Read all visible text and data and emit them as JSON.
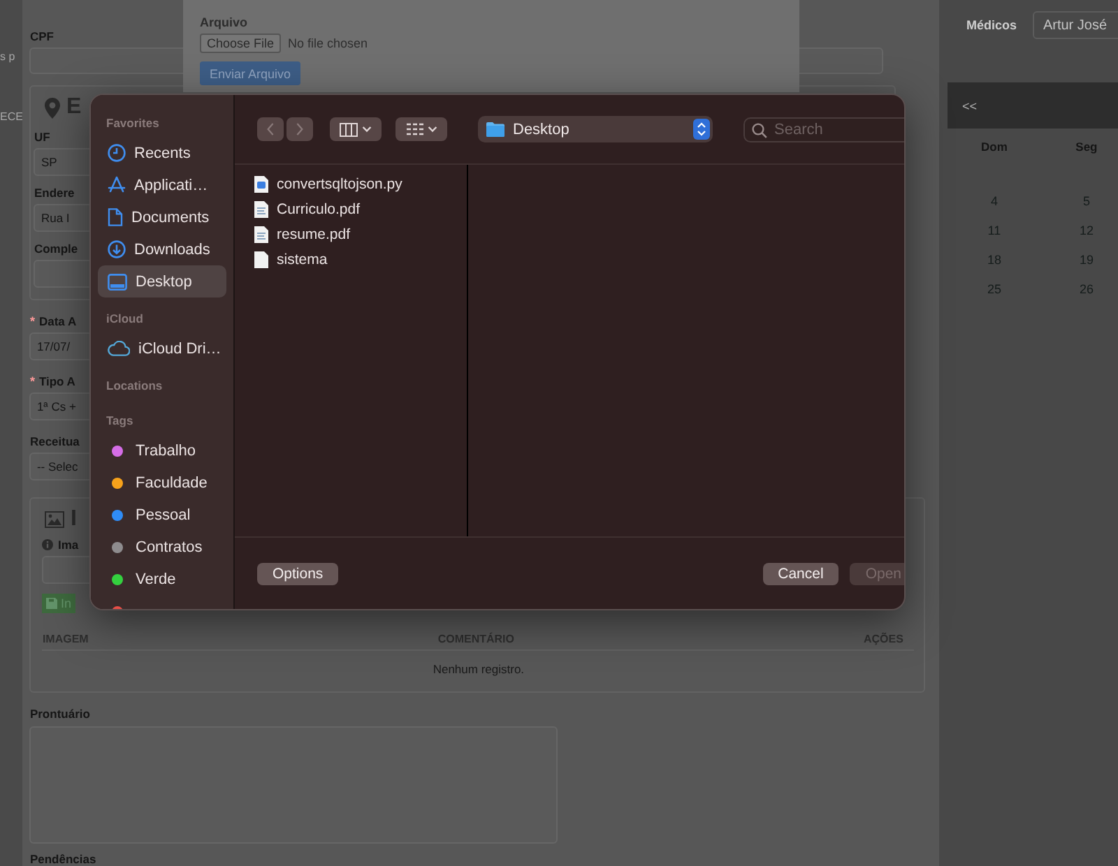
{
  "form": {
    "side_fragments": [
      "s p",
      "ECE"
    ],
    "cpf_label": "CPF",
    "address": {
      "title": "E",
      "fields": [
        {
          "label": "UF",
          "value": "SP"
        },
        {
          "label": "Endere",
          "value": "Rua I"
        },
        {
          "label": "Comple"
        }
      ]
    },
    "fields": [
      {
        "mark": "*",
        "label": "Data A",
        "value": "17/07/"
      },
      {
        "mark": "*",
        "label": "Tipo A",
        "value": "1ª Cs +"
      },
      {
        "label": "Receitua",
        "value": "-- Selec"
      }
    ],
    "images": {
      "title": "I",
      "field_label": "Ima",
      "button": "In",
      "columns": [
        "IMAGEM",
        "COMENTÁRIO",
        "AÇÕES"
      ],
      "empty_text": "Nenhum registro."
    },
    "notes": {
      "label": "Prontuário"
    },
    "pending": {
      "label": "Pendências"
    }
  },
  "doctors": {
    "label": "Médicos",
    "value": "Artur José"
  },
  "calendar": {
    "prev": "<<",
    "days": [
      "Dom",
      "Seg"
    ],
    "weeks": [
      [
        "4",
        "5"
      ],
      [
        "11",
        "12"
      ],
      [
        "18",
        "19"
      ],
      [
        "25",
        "26"
      ]
    ]
  },
  "upload": {
    "label": "Arquivo",
    "choose_button": "Choose File",
    "file_status": "No file chosen",
    "submit_button": "Enviar Arquivo"
  },
  "dialog": {
    "sidebar": [
      {
        "title": "Favorites",
        "items": [
          {
            "label": "Recents",
            "selected": false
          },
          {
            "label": "Applicati…",
            "selected": false
          },
          {
            "label": "Documents",
            "selected": false
          },
          {
            "label": "Downloads",
            "selected": false
          },
          {
            "label": "Desktop",
            "selected": true
          }
        ]
      },
      {
        "title": "iCloud",
        "items": [
          {
            "label": "iCloud Dri…",
            "selected": false
          }
        ]
      },
      {
        "title": "Locations"
      },
      {
        "title": "Tags",
        "items": [
          {
            "label": "Trabalho",
            "color": "#d56de6",
            "selected": false
          },
          {
            "label": "Faculdade",
            "color": "#f7a21b",
            "selected": false
          },
          {
            "label": "Pessoal",
            "color": "#2f8cf6",
            "selected": false
          },
          {
            "label": "Contratos",
            "color": "#8e8c8e",
            "selected": false
          },
          {
            "label": "Verde",
            "color": "#34d13f",
            "selected": false
          },
          {
            "color": "#ea4e47",
            "selected": false
          }
        ]
      }
    ],
    "location": "Desktop",
    "search": {
      "placeholder": "Search"
    },
    "files": [
      {
        "name": "convertsqltojson.py",
        "kind": "script"
      },
      {
        "name": "Curriculo.pdf",
        "kind": "pdf"
      },
      {
        "name": "resume.pdf",
        "kind": "pdf"
      },
      {
        "name": "sistema",
        "kind": "document"
      }
    ],
    "buttons": {
      "options": "Options",
      "cancel": "Cancel",
      "open": {
        "label": "Open",
        "disabled": true
      }
    }
  }
}
